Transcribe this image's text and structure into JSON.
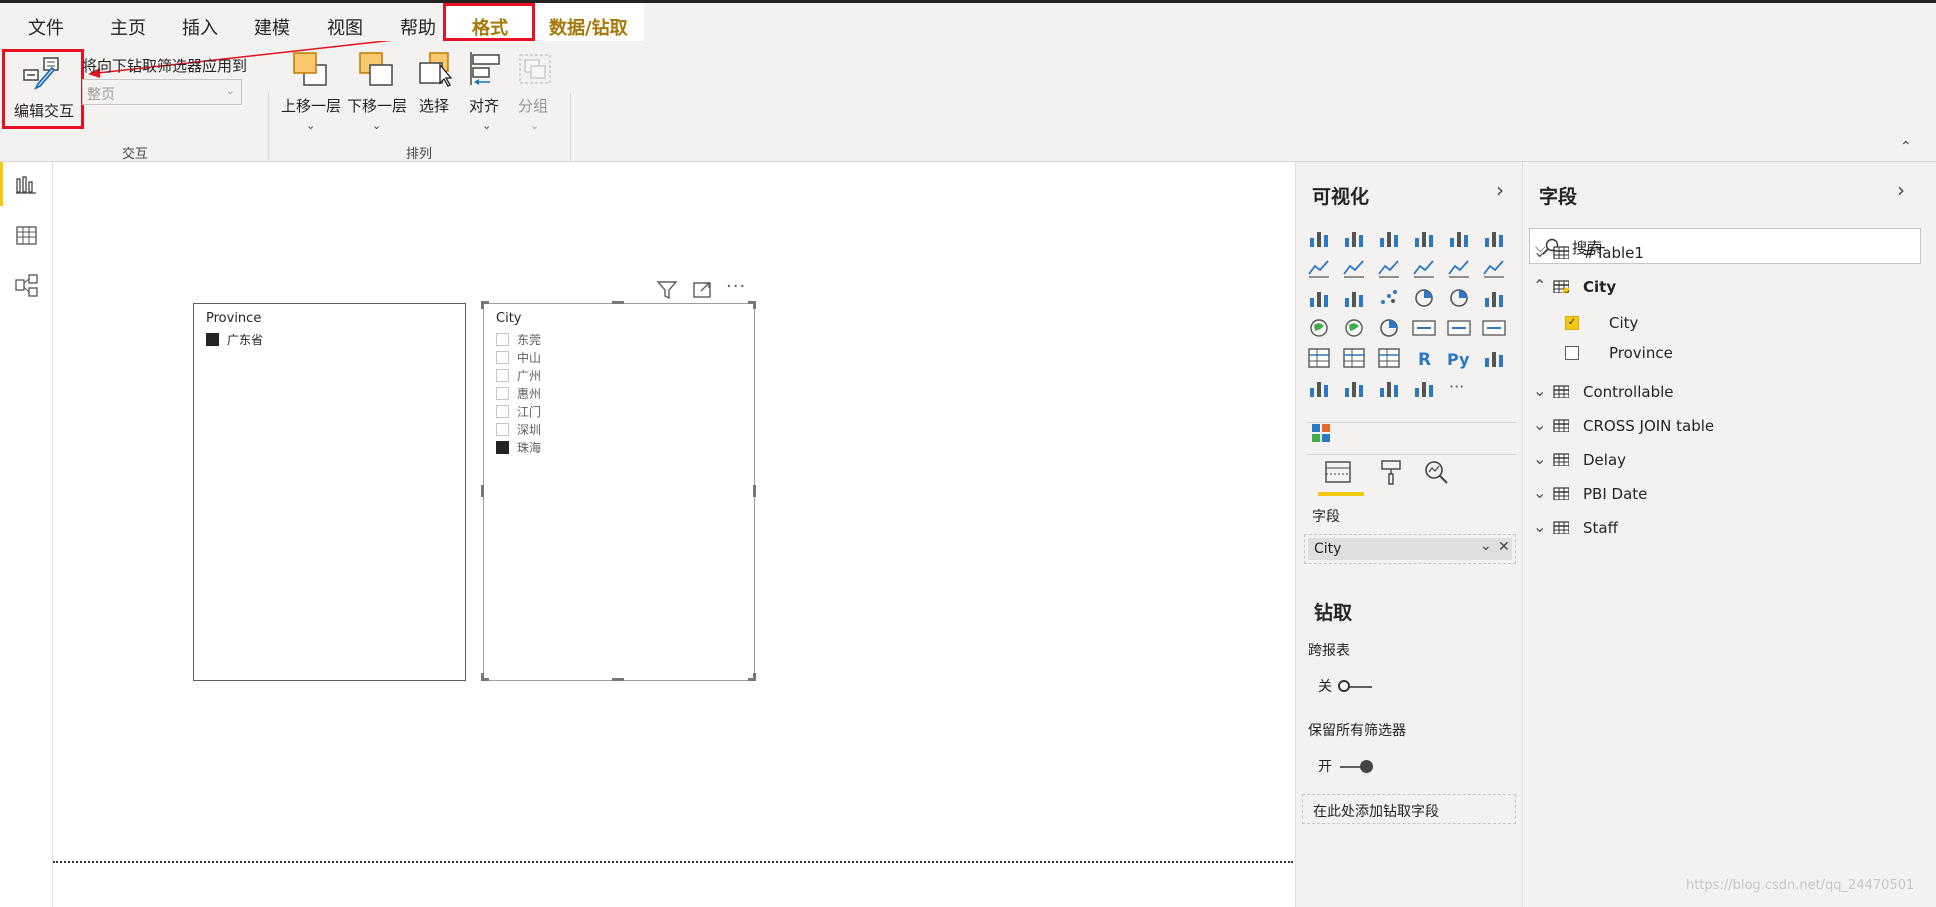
{
  "menu": {
    "items": [
      "文件",
      "主页",
      "插入",
      "建模",
      "视图",
      "帮助"
    ],
    "active": "格式",
    "data_drill": "数据/钻取"
  },
  "ribbon": {
    "edit_interactions": "编辑交互",
    "apply_drill_label": "将向下钻取筛选器应用到",
    "apply_drill_value": "整页",
    "group_interaction": "交互",
    "bring_forward": "上移一层",
    "send_backward": "下移一层",
    "select": "选择",
    "align": "对齐",
    "group": "分组",
    "group_arrange": "排列"
  },
  "colors": {
    "accent": "#f2c811",
    "annotation": "#e81123",
    "brand_gold": "#a6790d"
  },
  "slicer_province": {
    "title": "Province",
    "items": [
      {
        "label": "广东省",
        "checked": true
      }
    ]
  },
  "slicer_city": {
    "title": "City",
    "items": [
      {
        "label": "东莞",
        "checked": false
      },
      {
        "label": "中山",
        "checked": false
      },
      {
        "label": "广州",
        "checked": false
      },
      {
        "label": "惠州",
        "checked": false
      },
      {
        "label": "江门",
        "checked": false
      },
      {
        "label": "深圳",
        "checked": false
      },
      {
        "label": "珠海",
        "checked": true
      }
    ]
  },
  "viz": {
    "title": "可视化",
    "fields_tab_label": "字段",
    "field_well_value": "City",
    "drill_title": "钻取",
    "cross_report_label": "跨报表",
    "cross_report_state": "关",
    "keep_filters_label": "保留所有筛选器",
    "keep_filters_state": "开",
    "add_drill_field": "在此处添加钻取字段"
  },
  "fields": {
    "title": "字段",
    "search_placeholder": "搜索",
    "tables": [
      "#Table1",
      "City",
      "Controllable",
      "CROSS JOIN table",
      "Delay",
      "PBI Date",
      "Staff"
    ],
    "city_fields": [
      {
        "label": "City",
        "checked": true
      },
      {
        "label": "Province",
        "checked": false
      }
    ]
  },
  "watermark": "https://blog.csdn.net/qq_24470501"
}
